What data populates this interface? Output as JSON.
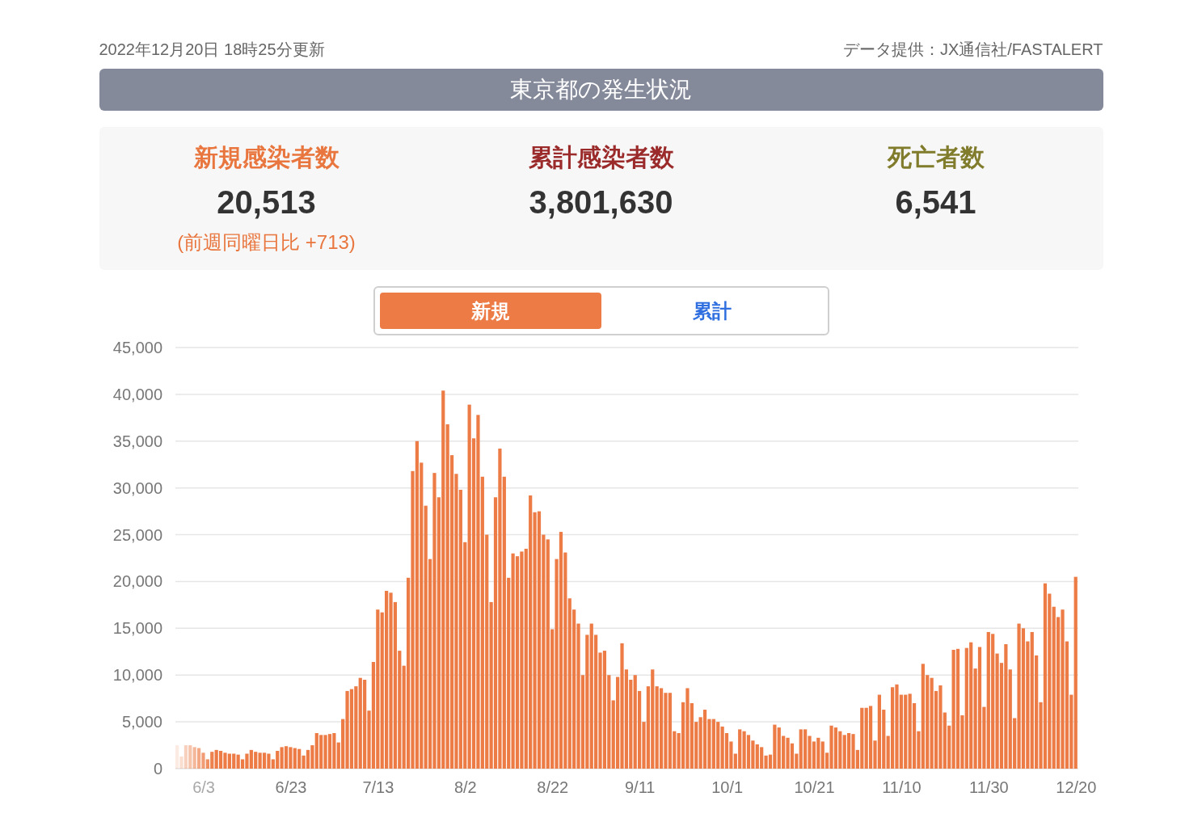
{
  "header": {
    "updated": "2022年12月20日 18時25分更新",
    "source": "データ提供：JX通信社/FASTALERT"
  },
  "title": "東京都の発生状況",
  "stats": [
    {
      "kind": "new",
      "label": "新規感染者数",
      "value": "20,513",
      "note": "(前週同曜日比 +713)"
    },
    {
      "kind": "total",
      "label": "累計感染者数",
      "value": "3,801,630"
    },
    {
      "kind": "deaths",
      "label": "死亡者数",
      "value": "6,541"
    }
  ],
  "tabs": [
    {
      "label": "新規",
      "selected": true
    },
    {
      "label": "累計",
      "selected": false
    }
  ],
  "chart": {
    "chart_data": {
      "type": "bar",
      "grid": true,
      "categories": [
        null,
        null,
        null,
        null,
        null,
        null,
        "6/3",
        null,
        null,
        null,
        null,
        null,
        null,
        null,
        null,
        null,
        null,
        null,
        null,
        null,
        null,
        null,
        null,
        null,
        null,
        null,
        "6/23",
        null,
        null,
        null,
        null,
        null,
        null,
        null,
        null,
        null,
        null,
        null,
        null,
        null,
        null,
        null,
        null,
        null,
        null,
        null,
        "7/13",
        null,
        null,
        null,
        null,
        null,
        null,
        null,
        null,
        null,
        null,
        null,
        null,
        null,
        null,
        null,
        null,
        null,
        null,
        null,
        "8/2",
        null,
        null,
        null,
        null,
        null,
        null,
        null,
        null,
        null,
        null,
        null,
        null,
        null,
        null,
        null,
        null,
        null,
        null,
        null,
        "8/22",
        null,
        null,
        null,
        null,
        null,
        null,
        null,
        null,
        null,
        null,
        null,
        null,
        null,
        null,
        null,
        null,
        null,
        null,
        null,
        "9/11",
        null,
        null,
        null,
        null,
        null,
        null,
        null,
        null,
        null,
        null,
        null,
        null,
        null,
        null,
        null,
        null,
        null,
        null,
        null,
        "10/1",
        null,
        null,
        null,
        null,
        null,
        null,
        null,
        null,
        null,
        null,
        null,
        null,
        null,
        null,
        null,
        null,
        null,
        null,
        null,
        "10/21",
        null,
        null,
        null,
        null,
        null,
        null,
        null,
        null,
        null,
        null,
        null,
        null,
        null,
        null,
        null,
        null,
        null,
        null,
        null,
        "11/10",
        null,
        null,
        null,
        null,
        null,
        null,
        null,
        null,
        null,
        null,
        null,
        null,
        null,
        null,
        null,
        null,
        null,
        null,
        null,
        "11/30",
        null,
        null,
        null,
        null,
        null,
        null,
        null,
        null,
        null,
        null,
        null,
        null,
        null,
        null,
        null,
        null,
        null,
        null,
        null,
        "12/20"
      ],
      "values": [
        2500,
        1300,
        2500,
        2500,
        2300,
        2200,
        1700,
        1000,
        1800,
        2000,
        1900,
        1700,
        1600,
        1600,
        1500,
        1000,
        1600,
        2000,
        1800,
        1700,
        1700,
        1600,
        1000,
        1900,
        2300,
        2400,
        2300,
        2200,
        2100,
        1400,
        2000,
        2500,
        3800,
        3600,
        3600,
        3700,
        3800,
        2800,
        5300,
        8300,
        8500,
        8800,
        9700,
        9500,
        6200,
        11400,
        17000,
        16700,
        19000,
        18800,
        17800,
        12600,
        11000,
        20400,
        31800,
        35000,
        32700,
        28100,
        22400,
        31600,
        29000,
        40400,
        36800,
        33500,
        31500,
        29800,
        24200,
        38900,
        35300,
        37800,
        31200,
        25000,
        17800,
        29000,
        34200,
        31200,
        20400,
        23000,
        22700,
        23200,
        23500,
        29200,
        27400,
        27500,
        25000,
        24500,
        14900,
        22400,
        25300,
        23100,
        18200,
        17000,
        15500,
        10000,
        14300,
        15500,
        14300,
        12400,
        12600,
        10000,
        7300,
        9800,
        13400,
        10600,
        9500,
        10000,
        8300,
        5000,
        8800,
        10600,
        8800,
        8600,
        8100,
        8100,
        4000,
        3800,
        7100,
        8600,
        7000,
        5000,
        5500,
        6300,
        5300,
        5300,
        5000,
        4500,
        3800,
        2900,
        1600,
        4200,
        4000,
        3600,
        3000,
        2600,
        2300,
        1400,
        1500,
        4700,
        4400,
        3500,
        3300,
        2700,
        1600,
        4200,
        4200,
        3500,
        2900,
        3300,
        2900,
        1700,
        4600,
        4400,
        4000,
        3600,
        3800,
        3700,
        2000,
        6500,
        6500,
        6700,
        3000,
        7900,
        6300,
        3500,
        8700,
        9000,
        7900,
        7900,
        8000,
        7000,
        4000,
        11200,
        10000,
        9700,
        8300,
        8900,
        6000,
        4600,
        12700,
        12800,
        5700,
        12900,
        13500,
        10700,
        13000,
        6600,
        14600,
        14400,
        12300,
        11300,
        13300,
        10600,
        5400,
        15500,
        15000,
        13600,
        14600,
        12100,
        7100,
        19800,
        18700,
        17300,
        16200,
        17000,
        13600,
        7900,
        20500
      ],
      "ylim": [
        0,
        45000
      ],
      "yticks": [
        {
          "value": 0,
          "label": "0"
        },
        {
          "value": 5000,
          "label": "5,000"
        },
        {
          "value": 10000,
          "label": "10,000"
        },
        {
          "value": 15000,
          "label": "15,000"
        },
        {
          "value": 20000,
          "label": "20,000"
        },
        {
          "value": 25000,
          "label": "25,000"
        },
        {
          "value": 30000,
          "label": "30,000"
        },
        {
          "value": 35000,
          "label": "35,000"
        },
        {
          "value": 40000,
          "label": "40,000"
        },
        {
          "value": 45000,
          "label": "45,000"
        }
      ]
    }
  }
}
